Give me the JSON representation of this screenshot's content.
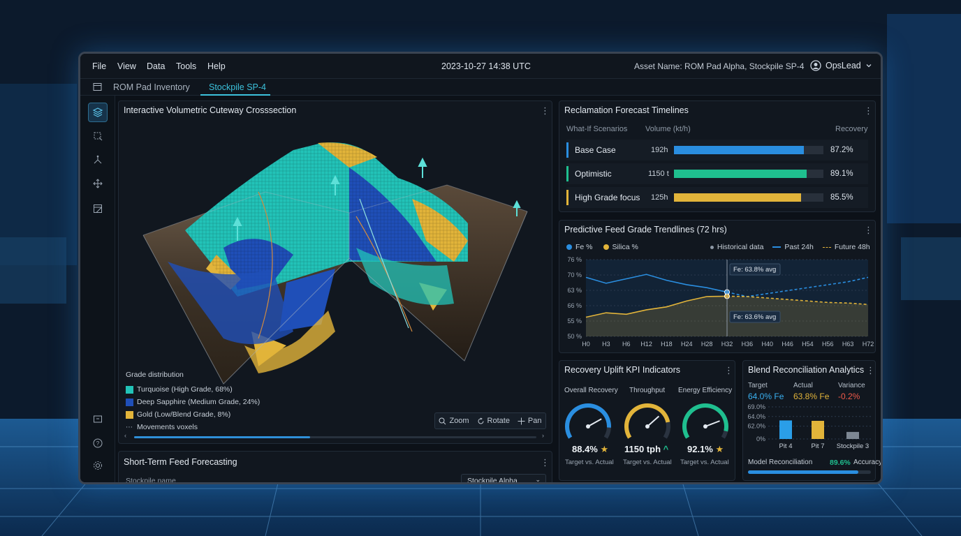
{
  "menubar": {
    "items": [
      "File",
      "View",
      "Data",
      "Tools",
      "Help"
    ],
    "timestamp": "2023-10-27 14:38 UTC",
    "asset": "Asset Name: ROM Pad Alpha, Stockpile SP-4",
    "user": "OpsLead"
  },
  "tabs": [
    {
      "label": "ROM Pad Inventory",
      "active": false
    },
    {
      "label": "Stockpile SP-4",
      "active": true
    }
  ],
  "sidebar": {
    "icons": [
      "layers-icon",
      "transform-icon",
      "network-icon",
      "move-icon",
      "layout-icon",
      "annotate-icon",
      "help-icon",
      "settings-icon"
    ]
  },
  "cutaway": {
    "title": "Interactive Volumetric Cuteway Crosssection",
    "legend": {
      "title": "Grade distribution",
      "items": [
        {
          "label": "Turquoise (High Grade, 68%)",
          "color": "#22c3b8"
        },
        {
          "label": "Deep Sapphire (Medium Grade, 24%)",
          "color": "#1f4fb8"
        },
        {
          "label": "Gold (Low/Blend Grade, 8%)",
          "color": "#e2b43a"
        }
      ],
      "movements": "Movements voxels"
    },
    "controls": {
      "zoom": "Zoom",
      "rotate": "Rotate",
      "pan": "Pan"
    }
  },
  "feed": {
    "title": "Short-Term Feed Forecasting",
    "field_label": "Stockpile name",
    "field_value": "Stockpile Alpha"
  },
  "reclamation": {
    "title": "Reclamation Forecast Timelines",
    "headers": {
      "scenario": "What-If Scenarios",
      "volume": "Volume (kt/h)",
      "recovery": "Recovery"
    },
    "rows": [
      {
        "name": "Base Case",
        "volume": "192h",
        "fill": 0.87,
        "recovery": "87.2%",
        "color": "#2a8ee0"
      },
      {
        "name": "Optimistic",
        "volume": "1150 t",
        "fill": 0.89,
        "recovery": "89.1%",
        "color": "#1fbf8f"
      },
      {
        "name": "High Grade focus",
        "volume": "125h",
        "fill": 0.85,
        "recovery": "85.5%",
        "color": "#e2b43a"
      }
    ]
  },
  "trend": {
    "title": "Predictive Feed Grade Trendlines (72 hrs)",
    "legend": {
      "fe": "Fe %",
      "silica": "Silica %",
      "historical": "Historical data",
      "past": "Past 24h",
      "future": "Future 48h"
    },
    "callouts": {
      "fe": "Fe: 63.8% avg",
      "silica": "Fe: 63.6% avg"
    }
  },
  "chart_data": {
    "type": "line",
    "title": "Predictive Feed Grade Trendlines (72 hrs)",
    "x": [
      "H0",
      "H3",
      "H6",
      "H12",
      "H18",
      "H24",
      "H28",
      "H32",
      "H36",
      "H40",
      "H46",
      "H54",
      "H56",
      "H63",
      "H72"
    ],
    "yticks": [
      "76 %",
      "70 %",
      "63 %",
      "66 %",
      "55 %",
      "50 %"
    ],
    "series": [
      {
        "name": "Fe %",
        "color": "#2a8ee0",
        "values": [
          70,
          68,
          69.5,
          71,
          69,
          67.5,
          66.5,
          65,
          63.5,
          64.5,
          65.5,
          66.5,
          67.5,
          68.5,
          70
        ]
      },
      {
        "name": "Silica %",
        "color": "#e2b43a",
        "values": [
          56.5,
          58,
          57.5,
          59,
          60,
          62,
          63.5,
          63.6,
          63.5,
          63,
          62.5,
          62,
          61.5,
          61.3,
          60.8
        ]
      }
    ]
  },
  "kpi": {
    "title": "Recovery Uplift KPI Indicators",
    "gauges": [
      {
        "label": "Overall Recovery",
        "value": "88.4%",
        "mark": "★",
        "sub": "Target vs. Actual",
        "color": "#2a8ee0",
        "level": 0.88
      },
      {
        "label": "Throughput",
        "value": "1150 tph",
        "mark": "^",
        "sub": "Target vs. Actual",
        "color": "#e2b43a",
        "level": 0.82
      },
      {
        "label": "Energy Efficiency",
        "value": "92.1%",
        "mark": "★",
        "sub": "Target vs. Actual",
        "color": "#1fbf8f",
        "level": 0.92
      }
    ]
  },
  "blend": {
    "title": "Blend Reconciliation Analytics",
    "target_label": "Target",
    "target_value": "64.0% Fe",
    "actual_label": "Actual",
    "actual_value": "63.8% Fe",
    "variance_label": "Variance",
    "variance_value": "-0.2%",
    "yticks": [
      "69.0%",
      "64.0%",
      "62.0%",
      "0%"
    ],
    "bars": [
      {
        "label": "Pit 4",
        "value": 64.0,
        "color": "#2a9ee8"
      },
      {
        "label": "Pit 7",
        "value": 63.8,
        "color": "#e2b43a"
      },
      {
        "label": "Stockpile 3",
        "value": 20,
        "color": "#7d8793"
      }
    ],
    "model_label": "Model Reconciliation",
    "model_value": "89.6%",
    "model_suffix": "Accuracy",
    "model_level": 0.9
  }
}
